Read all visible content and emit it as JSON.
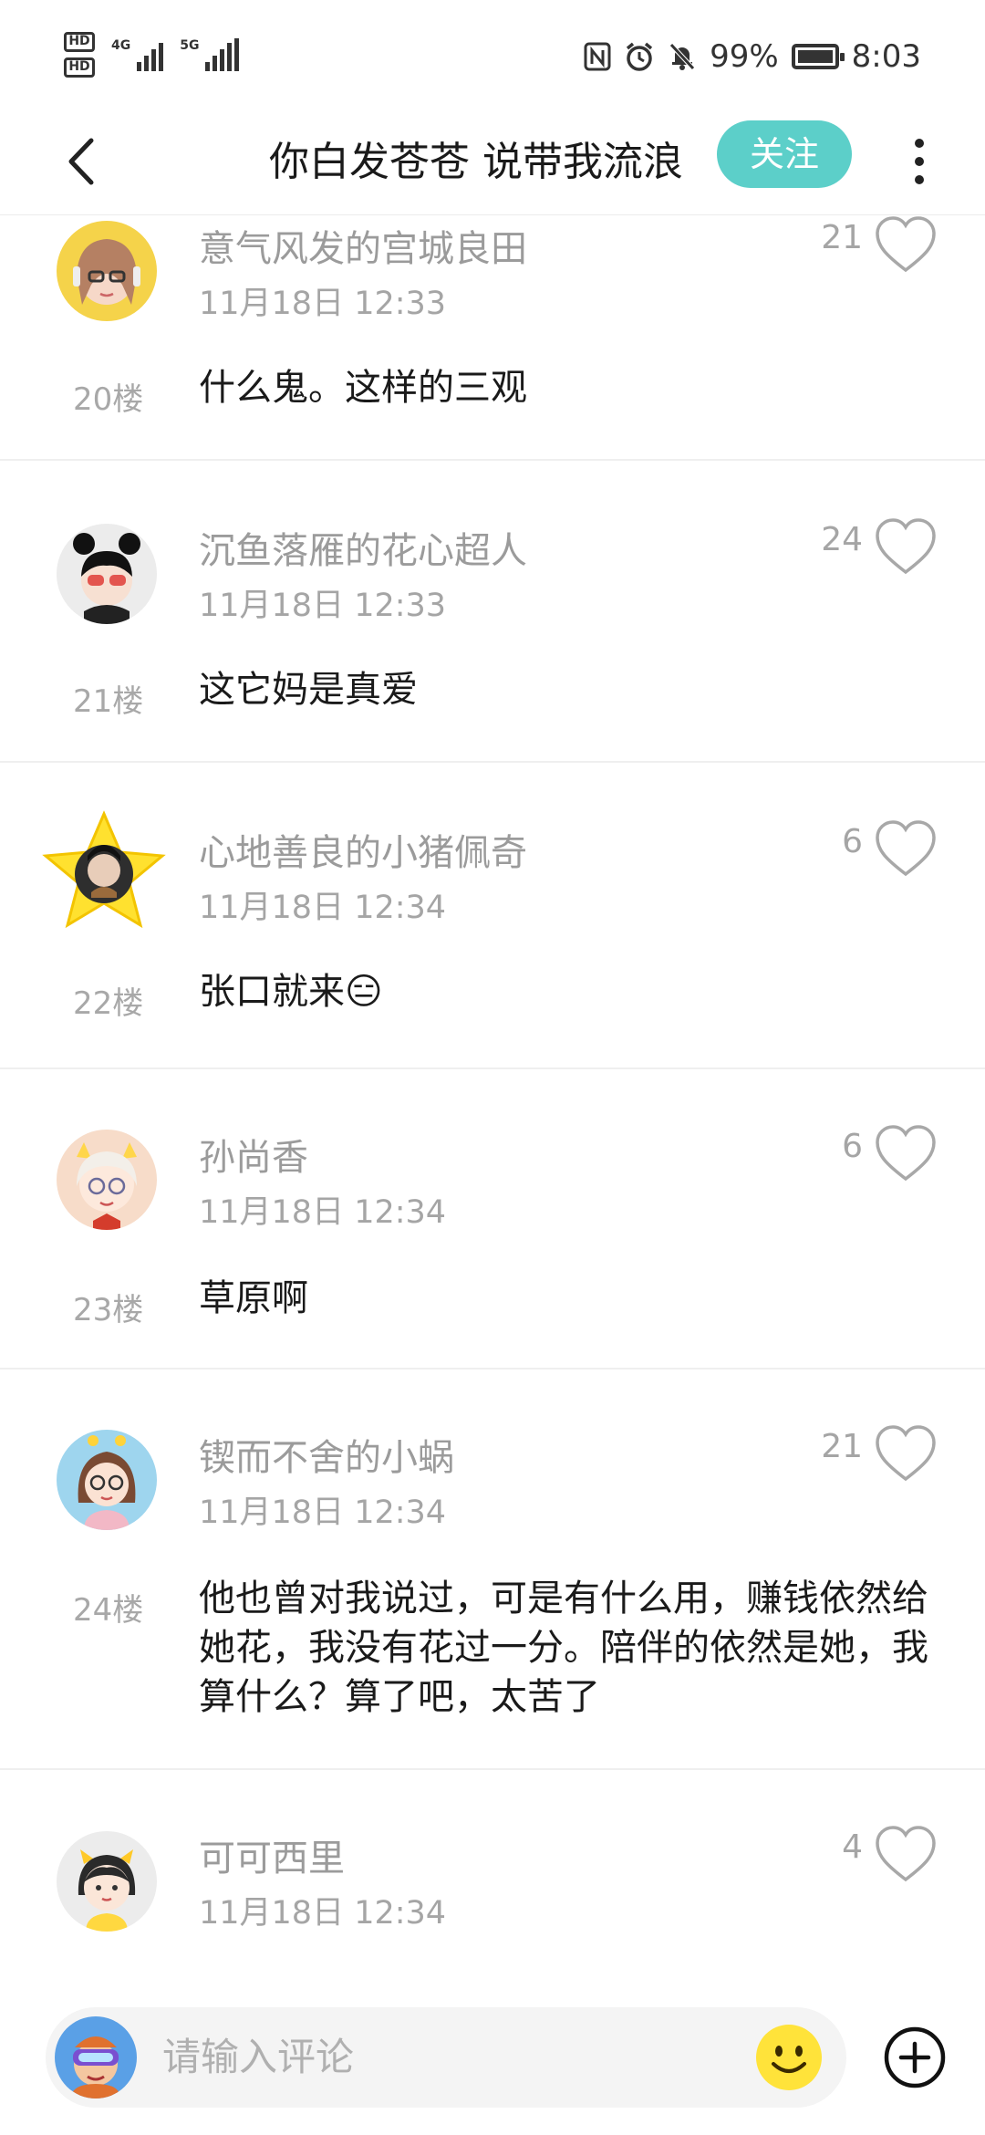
{
  "status_bar": {
    "hd1": "HD",
    "hd2": "HD",
    "net1": "4G",
    "net2": "5G",
    "battery": "99%",
    "time": "8:03"
  },
  "header": {
    "title": "你白发苍苍 说带我流浪",
    "follow_label": "关注"
  },
  "comments": [
    {
      "username": "意气风发的宫城良田",
      "time": "11月18日 12:33",
      "floor": "20楼",
      "likes": "21",
      "content": "什么鬼。这样的三观"
    },
    {
      "username": "沉鱼落雁的花心超人",
      "time": "11月18日 12:33",
      "floor": "21楼",
      "likes": "24",
      "content": "这它妈是真爱"
    },
    {
      "username": "心地善良的小猪佩奇",
      "time": "11月18日 12:34",
      "floor": "22楼",
      "likes": "6",
      "content": "张口就来😑"
    },
    {
      "username": "孙尚香",
      "time": "11月18日 12:34",
      "floor": "23楼",
      "likes": "6",
      "content": "草原啊"
    },
    {
      "username": "锲而不舍的小蜗",
      "time": "11月18日 12:34",
      "floor": "24楼",
      "likes": "21",
      "content": "他也曾对我说过，可是有什么用，赚钱依然给她花，我没有花过一分。陪伴的依然是她，我算什么？算了吧，太苦了"
    },
    {
      "username": "可可西里",
      "time": "11月18日 12:34",
      "floor": "",
      "likes": "4",
      "content": ""
    }
  ],
  "input": {
    "placeholder": "请输入评论"
  },
  "colors": {
    "accent": "#5ccfc9",
    "emoji_yellow": "#ffe33a"
  }
}
